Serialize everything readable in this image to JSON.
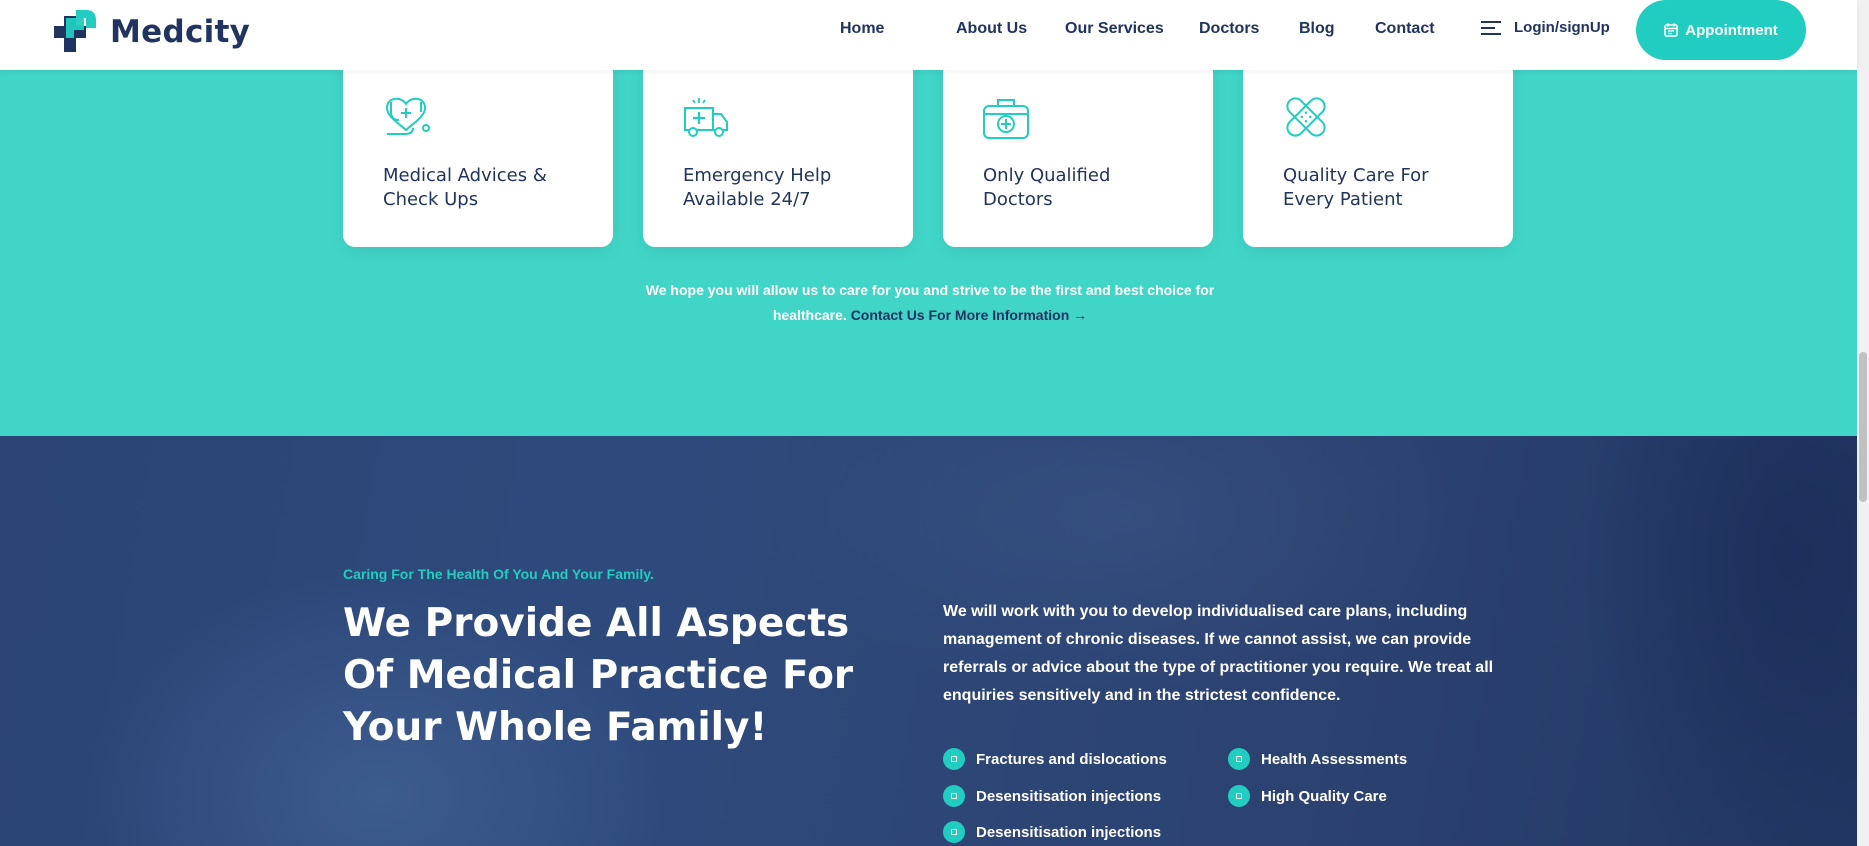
{
  "brand": {
    "name": "Medcity",
    "accent": "#21cdc0",
    "navy": "#213360",
    "teal_bg": "#41d5c8"
  },
  "nav": {
    "items": [
      "Home",
      "About Us",
      "Our Services",
      "Doctors",
      "Blog",
      "Contact"
    ],
    "login_label": "Login/signUp",
    "appointment_label": "Appointment"
  },
  "features": [
    {
      "icon": "stethoscope-heart-icon",
      "title": "Medical Advices & Check Ups"
    },
    {
      "icon": "ambulance-icon",
      "title": "Emergency Help Available 24/7"
    },
    {
      "icon": "first-aid-kit-icon",
      "title": "Only Qualified Doctors"
    },
    {
      "icon": "bandage-icon",
      "title": "Quality Care For Every Patient"
    }
  ],
  "teal_note": {
    "text": "We hope you will allow us to care for you and strive to be the first and best choice for healthcare.",
    "link": "Contact Us For More Information →"
  },
  "about": {
    "eyebrow": "Caring For The Health Of You And Your Family.",
    "headline": "We Provide All Aspects Of Medical Practice For Your Whole Family!",
    "description": "We will work with you to develop individualised care plans, including management of chronic diseases. If we cannot assist, we can provide referrals or advice about the type of practitioner you require. We treat all enquiries sensitively and in the strictest confidence.",
    "list": [
      "Fractures and dislocations",
      "Health Assessments",
      "Desensitisation injections",
      "High Quality Care",
      "Desensitisation injections"
    ]
  }
}
